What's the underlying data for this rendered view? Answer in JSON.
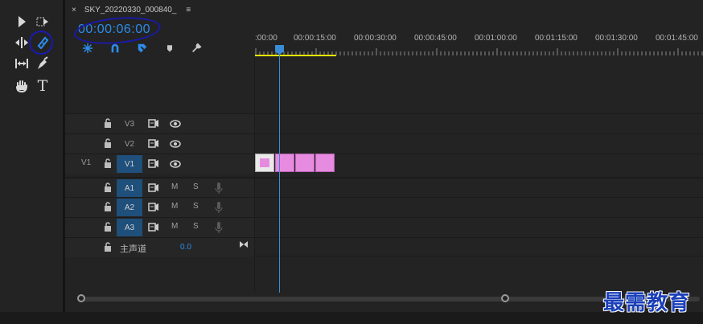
{
  "sequence": {
    "tab_title": "SKY_20220330_000840_",
    "close": "×",
    "menu": "≡"
  },
  "timecode": "00:00:06:00",
  "ruler": {
    "labels": [
      ":00:00",
      "00:00:15:00",
      "00:00:30:00",
      "00:00:45:00",
      "00:01:00:00",
      "00:01:15:00",
      "00:01:30:00",
      "00:01:45:00"
    ]
  },
  "tracks": {
    "video": [
      {
        "label": "V3",
        "source": "",
        "active": false
      },
      {
        "label": "V2",
        "source": "",
        "active": false
      },
      {
        "label": "V1",
        "source": "V1",
        "active": true
      }
    ],
    "audio": [
      {
        "label": "A1",
        "m": "M",
        "s": "S"
      },
      {
        "label": "A2",
        "m": "M",
        "s": "S"
      },
      {
        "label": "A3",
        "m": "M",
        "s": "S"
      }
    ],
    "master": {
      "label": "主声道",
      "value": "0.0"
    }
  },
  "tools": [
    "selection-tool",
    "track-select-tool",
    "razor-tool",
    "ripple-edit-tool",
    "slip-tool",
    "pen-tool",
    "hand-tool",
    "type-tool"
  ],
  "colors": {
    "accent": "#2d8ceb",
    "clip": "#e68be0",
    "workarea": "#e8e800",
    "track_active": "#1f4f7b"
  },
  "watermark": "最需教育"
}
